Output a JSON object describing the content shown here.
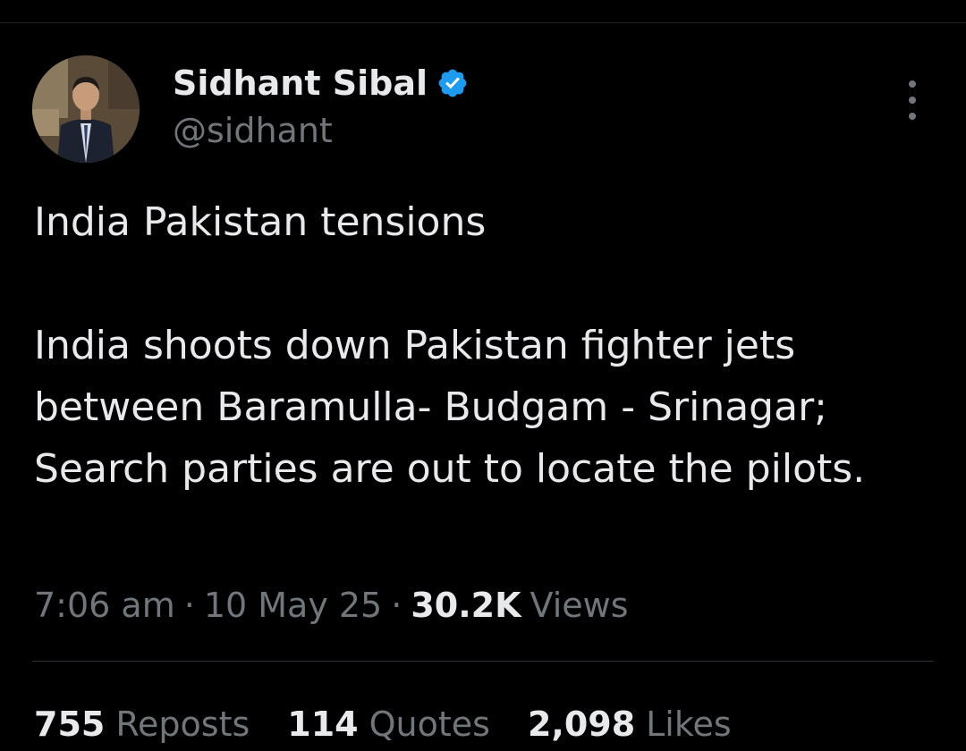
{
  "author": {
    "display_name": "Sidhant Sibal",
    "handle": "@sidhant",
    "verified": true,
    "avatar_icon": "profile-photo",
    "verified_icon": "verified-badge-icon",
    "verified_color": "#1d9bf0"
  },
  "tweet": {
    "paragraphs": [
      "India Pakistan tensions",
      "India shoots down Pakistan fighter jets between Baramulla- Budgam - Srinagar; Search parties are out to locate the pilots."
    ]
  },
  "meta": {
    "time": "7:06 am",
    "separator": "·",
    "date": "10 May 25",
    "views_count": "30.2K",
    "views_label": "Views"
  },
  "stats": {
    "reposts_count": "755",
    "reposts_label": "Reposts",
    "quotes_count": "114",
    "quotes_label": "Quotes",
    "likes_count": "2,098",
    "likes_label": "Likes"
  },
  "colors": {
    "background": "#000000",
    "primary_text": "#e7e9ea",
    "secondary_text": "#71767b",
    "divider": "#2f3336"
  },
  "icons": {
    "more": "more-options-icon"
  }
}
